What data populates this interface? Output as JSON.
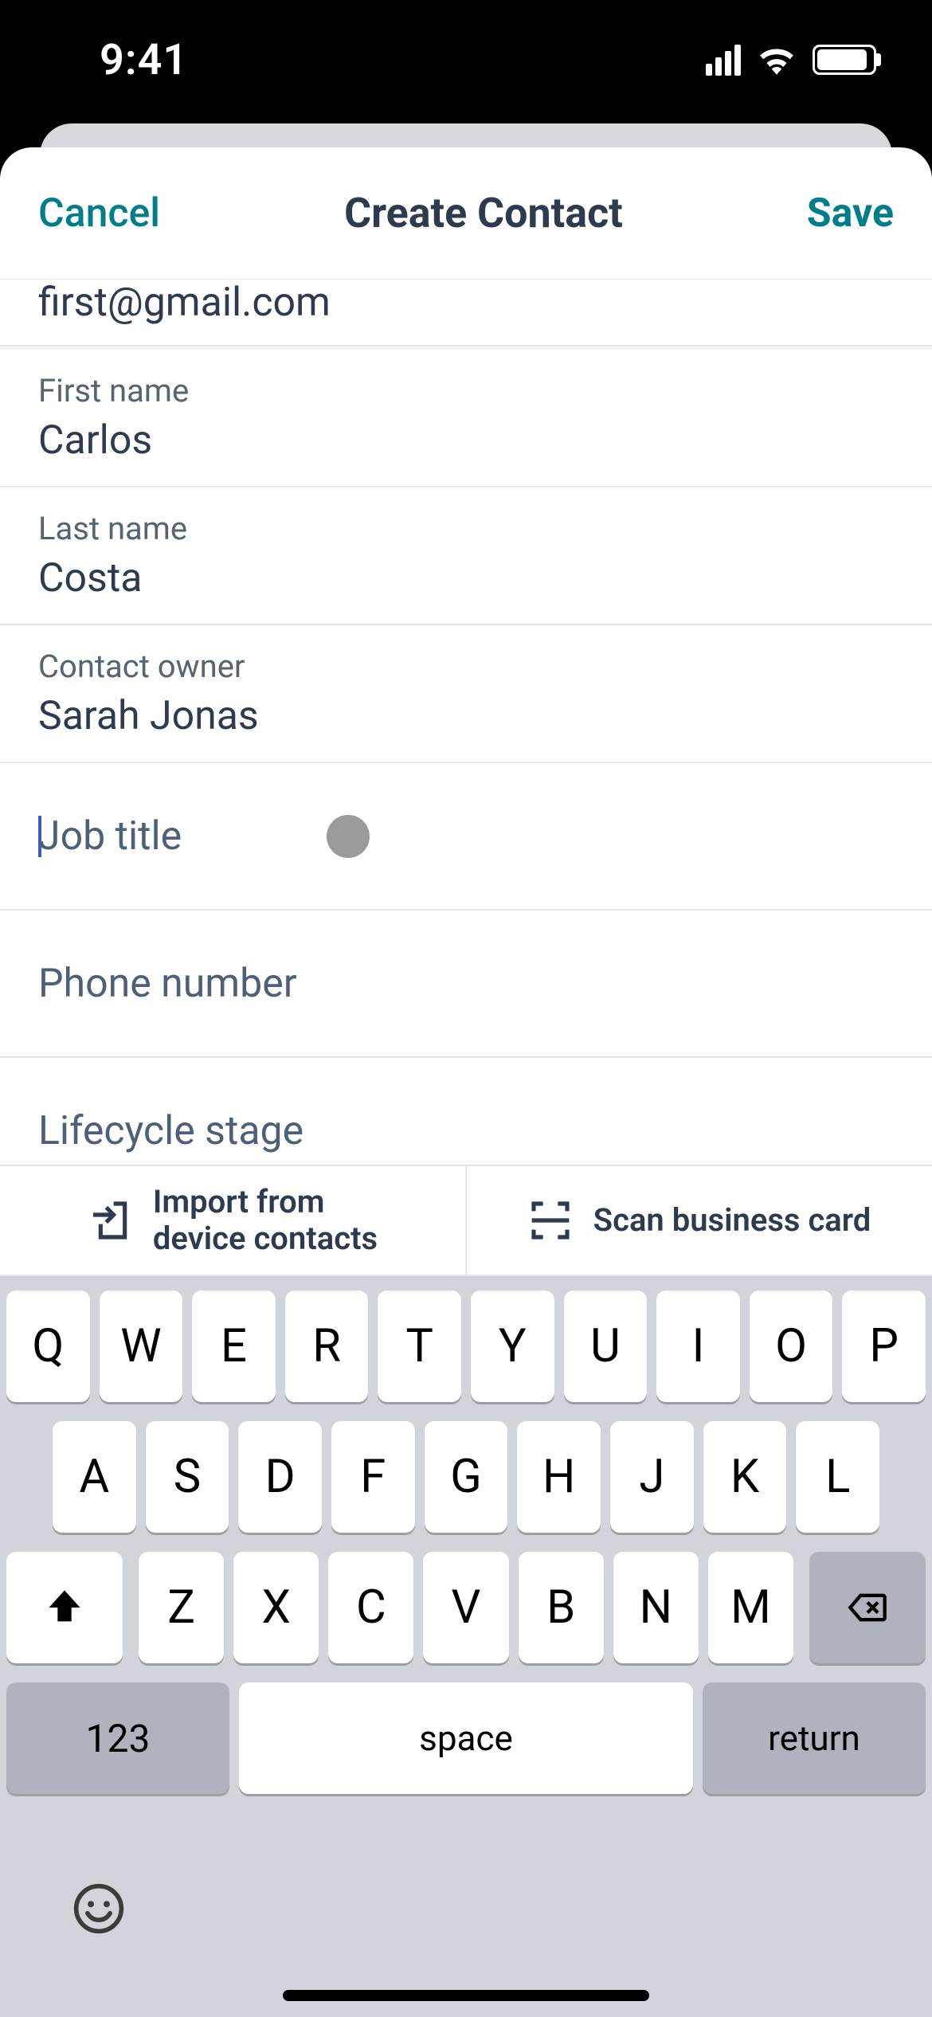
{
  "statusbar": {
    "time": "9:41"
  },
  "nav": {
    "cancel": "Cancel",
    "title": "Create Contact",
    "save": "Save"
  },
  "fields": {
    "email_value": "first@gmail.com",
    "first_name_label": "First name",
    "first_name_value": "Carlos",
    "last_name_label": "Last name",
    "last_name_value": "Costa",
    "owner_label": "Contact owner",
    "owner_value": "Sarah Jonas",
    "job_title_placeholder": "Job title",
    "phone_placeholder": "Phone number",
    "lifecycle_placeholder": "Lifecycle stage"
  },
  "actions": {
    "import_line1": "Import from",
    "import_line2": "device contacts",
    "scan": "Scan business card"
  },
  "keyboard": {
    "row1": [
      "Q",
      "W",
      "E",
      "R",
      "T",
      "Y",
      "U",
      "I",
      "O",
      "P"
    ],
    "row2": [
      "A",
      "S",
      "D",
      "F",
      "G",
      "H",
      "J",
      "K",
      "L"
    ],
    "row3": [
      "Z",
      "X",
      "C",
      "V",
      "B",
      "N",
      "M"
    ],
    "k123": "123",
    "space": "space",
    "return": "return"
  }
}
